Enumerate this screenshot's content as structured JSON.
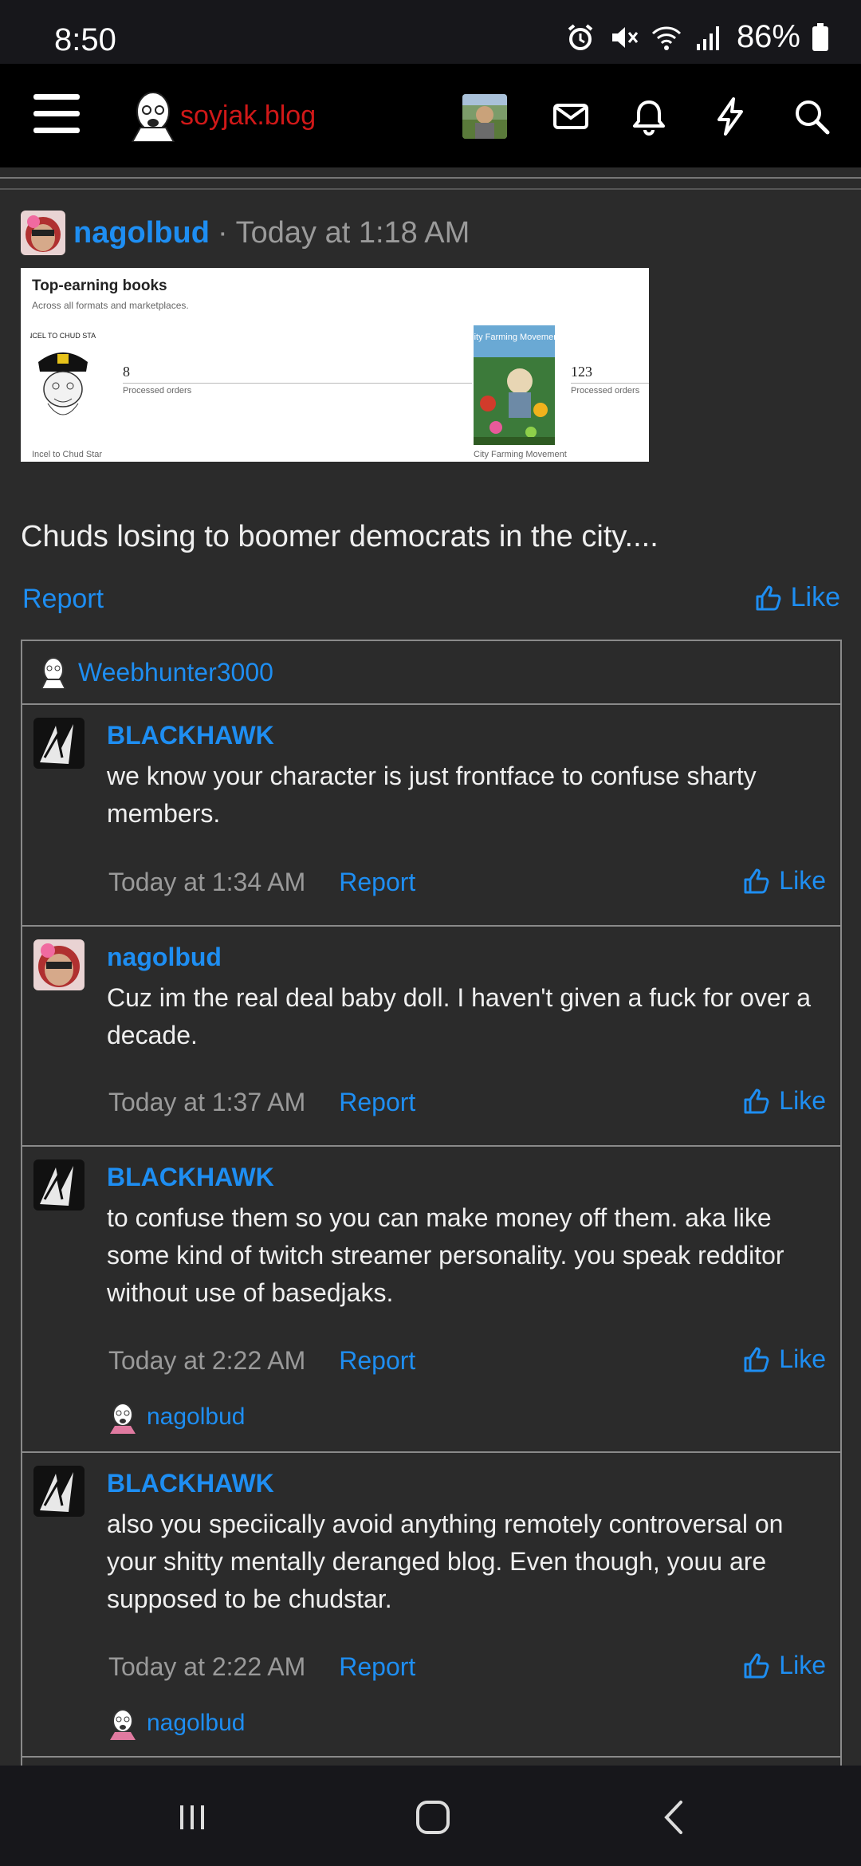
{
  "status_bar": {
    "time": "8:50",
    "battery": "86%"
  },
  "nav": {
    "site_name": "soyjak.blog"
  },
  "post": {
    "author": "nagolbud",
    "separator": "·",
    "time": "Today at 1:18 AM",
    "body": "Chuds losing to boomer democrats in the city....",
    "report_label": "Report",
    "like_label": "Like",
    "attachment": {
      "title": "Top-earning books",
      "subtitle": "Across all formats and marketplaces.",
      "books": [
        {
          "cover_text": "INCEL TO CHUD STAR",
          "count": "8",
          "count_label": "Processed orders",
          "name": "Incel to Chud Star"
        },
        {
          "cover_text": "City Farming Movement",
          "count": "123",
          "count_label": "Processed orders",
          "name": "City Farming Movement"
        }
      ]
    }
  },
  "comments_box": {
    "liker": "Weebhunter3000",
    "comments": [
      {
        "author": "BLACKHAWK",
        "text": "we know your character is just frontface to confuse sharty members.",
        "time": "Today at 1:34 AM",
        "report": "Report",
        "like": "Like"
      },
      {
        "author": "nagolbud",
        "text": "Cuz im the real deal baby doll. I haven't given a fuck for over a decade.",
        "time": "Today at 1:37 AM",
        "report": "Report",
        "like": "Like"
      },
      {
        "author": "BLACKHAWK",
        "text": "to confuse them so you can make money off them. aka like some kind of twitch streamer personality. you speak redditor without use of basedjaks.",
        "time": "Today at 2:22 AM",
        "report": "Report",
        "like": "Like",
        "reactor": "nagolbud"
      },
      {
        "author": "BLACKHAWK",
        "text": "also you speciically avoid anything remotely controversal on your shitty mentally deranged blog. Even though, youu are supposed to be chudstar.",
        "time": "Today at 2:22 AM",
        "report": "Report",
        "like": "Like",
        "reactor": "nagolbud"
      }
    ]
  },
  "colors": {
    "accent": "#1e8ef2",
    "background": "#2b2b2b",
    "navbar": "#000000",
    "logo": "#d01818"
  }
}
